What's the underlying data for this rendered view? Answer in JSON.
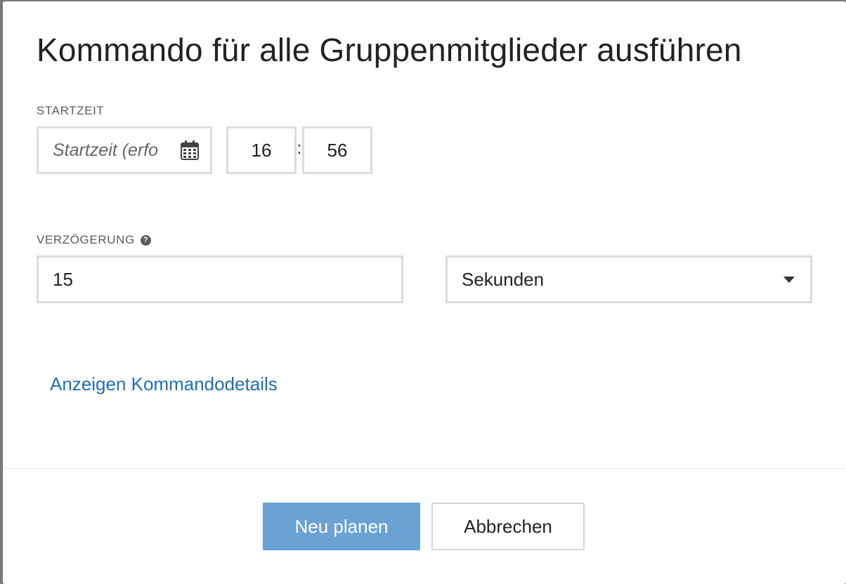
{
  "dialog": {
    "title": "Kommando für alle Gruppenmitglieder ausführen"
  },
  "start": {
    "label": "STARTZEIT",
    "date_placeholder": "Startzeit (erfo",
    "date_icon": "calendar-icon",
    "hour": "16",
    "separator": ":",
    "minute": "56"
  },
  "delay": {
    "label": "VERZÖGERUNG",
    "help_icon": "question-circle-icon",
    "help_glyph": "?",
    "value": "15",
    "unit_selected": "Sekunden"
  },
  "details_link": "Anzeigen Kommandodetails",
  "buttons": {
    "primary_label": "Neu planen",
    "cancel_label": "Abbrechen"
  },
  "colors": {
    "primary_button": "#6aa2d6",
    "link": "#1f6db5",
    "border": "#dcdcdc"
  }
}
